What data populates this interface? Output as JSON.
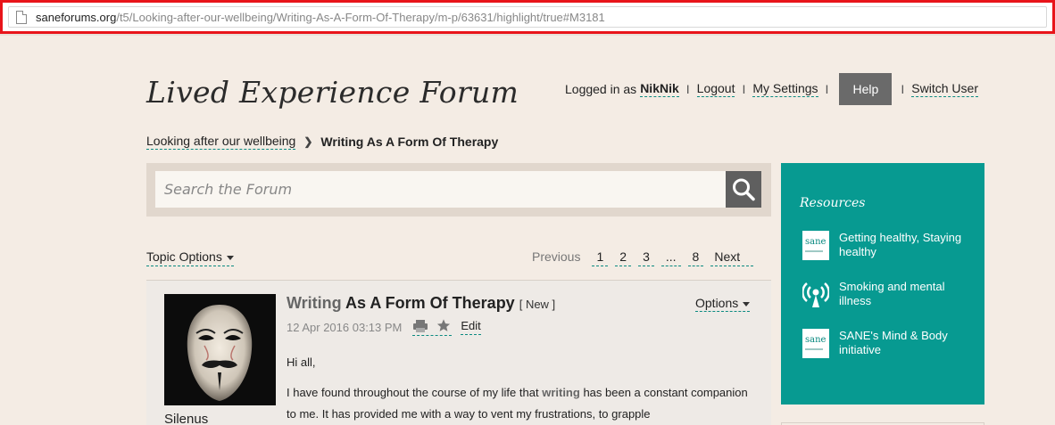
{
  "browser": {
    "url_host": "saneforums.org",
    "url_path": "/t5/Looking-after-our-wellbeing/Writing-As-A-Form-Of-Therapy/m-p/63631/highlight/true#M3181"
  },
  "header": {
    "forum_title": "Lived Experience Forum",
    "logged_in_prefix": "Logged in as",
    "username": "NikNik",
    "logout": "Logout",
    "my_settings": "My Settings",
    "help": "Help",
    "switch_user": "Switch User",
    "separator": "I"
  },
  "breadcrumb": {
    "parent": "Looking after our wellbeing",
    "current": "Writing As A Form Of Therapy"
  },
  "search": {
    "placeholder": "Search the Forum"
  },
  "topic_options": "Topic Options",
  "pagination": {
    "previous": "Previous",
    "pages": [
      "1",
      "2",
      "3",
      "...",
      "8"
    ],
    "next": "Next"
  },
  "post": {
    "author": "Silenus",
    "title_highlight": "Writing",
    "title_rest": "As A Form Of Therapy",
    "badge": "[ New ]",
    "options": "Options",
    "date": "12 Apr 2016 03:13 PM",
    "edit": "Edit",
    "greeting": "Hi all,",
    "body_start": "I have found throughout the course of my life that",
    "body_highlight": "writing",
    "body_rest": "has been a constant companion to me. It has provided me with a way to vent my frustrations, to grapple"
  },
  "resources": {
    "title": "Resources",
    "items": [
      {
        "label": "Getting healthy, Staying healthy",
        "icon": "sane-logo-icon"
      },
      {
        "label": "Smoking and mental illness",
        "icon": "broadcast-icon"
      },
      {
        "label": "SANE's Mind & Body initiative",
        "icon": "sane-logo-icon"
      }
    ],
    "logo_text": "sane"
  },
  "colors": {
    "background": "#f4ece4",
    "accent_teal": "#079a91",
    "help_button": "#6a6a6a",
    "url_highlight_border": "#e8141a"
  }
}
